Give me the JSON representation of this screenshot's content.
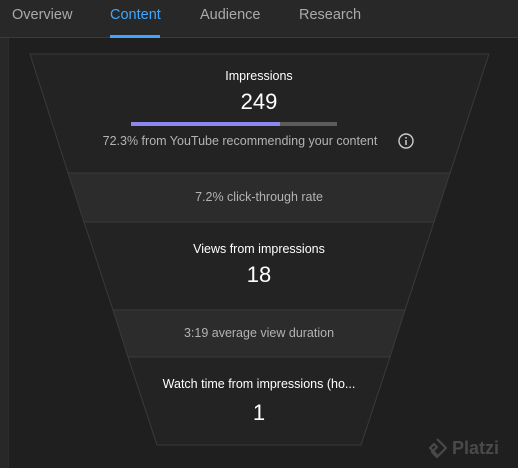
{
  "tabs": [
    {
      "label": "Overview",
      "active": false
    },
    {
      "label": "Content",
      "active": true
    },
    {
      "label": "Audience",
      "active": false
    },
    {
      "label": "Research",
      "active": false
    }
  ],
  "funnel": {
    "impressions": {
      "title": "Impressions",
      "value": "249",
      "recommendation_text": "72.3% from YouTube recommending your content",
      "recommendation_fraction": 0.723,
      "info_icon": "info-icon"
    },
    "ctr_text": "7.2% click-through rate",
    "views": {
      "title": "Views from impressions",
      "value": "18"
    },
    "avg_duration_text": "3:19 average view duration",
    "watch_time": {
      "title": "Watch time from impressions (ho...",
      "value": "1"
    }
  },
  "watermark": {
    "text": "Platzi"
  },
  "colors": {
    "accent": "#3ea6ff",
    "progress_fill": "#8c87f0",
    "progress_track": "#5c5c5c"
  }
}
